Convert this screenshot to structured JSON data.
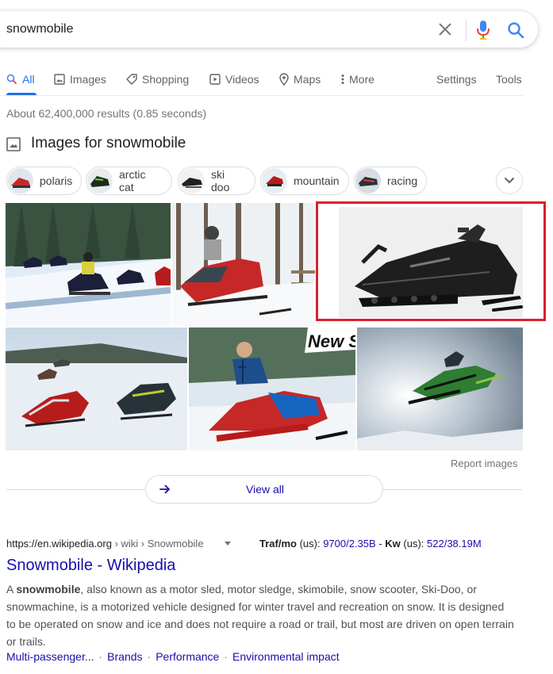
{
  "search": {
    "query": "snowmobile"
  },
  "nav": {
    "tabs": [
      {
        "label": "All",
        "active": true
      },
      {
        "label": "Images"
      },
      {
        "label": "Shopping"
      },
      {
        "label": "Videos"
      },
      {
        "label": "Maps"
      },
      {
        "label": "More"
      }
    ],
    "settings": "Settings",
    "tools": "Tools"
  },
  "stats": "About 62,400,000 results (0.85 seconds)",
  "images_section": {
    "heading": "Images for snowmobile",
    "chips": [
      "polaris",
      "arctic cat",
      "ski doo",
      "mountain",
      "racing"
    ],
    "overlay_text": "New S",
    "report": "Report images",
    "view_all": "View all"
  },
  "result": {
    "url_base": "https://en.wikipedia.org",
    "url_path": " › wiki › Snowmobile",
    "seo": {
      "traf_label": "Traf/mo",
      "traf_region": " (us): ",
      "traf_value": "9700/2.35B",
      "sep": " - ",
      "kw_label": "Kw",
      "kw_region": " (us): ",
      "kw_value": "522/38.19M"
    },
    "title": "Snowmobile - Wikipedia",
    "snippet_prefix": "A ",
    "snippet_bold": "snowmobile",
    "snippet_rest": ", also known as a motor sled, motor sledge, skimobile, snow scooter, Ski-Doo, or snowmachine, is a motorized vehicle designed for winter travel and recreation on snow. It is designed to be operated on snow and ice and does not require a road or trail, but most are driven on open terrain or trails.",
    "sitelinks": [
      "Multi-passenger...",
      "Brands",
      "Performance",
      "Environmental impact"
    ]
  },
  "colors": {
    "link": "#1a0dab",
    "accent": "#1a73e8",
    "highlight": "#d9202f"
  }
}
